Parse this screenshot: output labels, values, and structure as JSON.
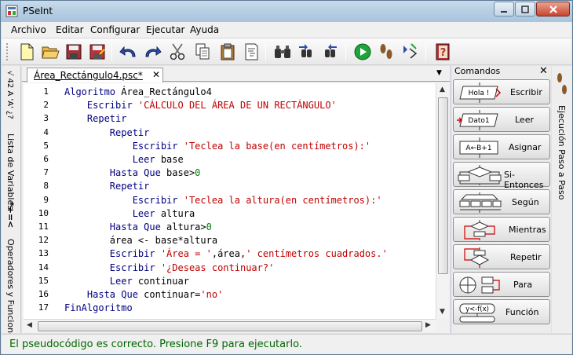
{
  "window": {
    "title": "PSeInt"
  },
  "menu": [
    "Archivo",
    "Editar",
    "Configurar",
    "Ejecutar",
    "Ayuda"
  ],
  "toolbar": {
    "buttons": [
      "new-file",
      "open-folder",
      "save",
      "save-as",
      "undo",
      "redo",
      "cut",
      "copy",
      "paste",
      "search",
      "find-next",
      "replace",
      "format",
      "run",
      "step-by-step",
      "draw-diagram",
      "help"
    ]
  },
  "left_strip": {
    "vars_symbol": "√ 42 A 'A' ¿?",
    "vars_label": "Lista de Variables",
    "ops_symbol": "*+=<",
    "ops_label": "Operadores y Funciones"
  },
  "tab": {
    "label": "Área_Rectángulo4.psc*",
    "close": "✕"
  },
  "code": {
    "lines": [
      [
        {
          "t": "Algoritmo ",
          "c": "kw"
        },
        {
          "t": "Área_Rectángulo4",
          "c": "id"
        }
      ],
      [
        {
          "t": "    Escribir ",
          "c": "kw"
        },
        {
          "t": "'CÁLCULO DEL ÁREA DE UN RECTÁNGULO'",
          "c": "str"
        }
      ],
      [
        {
          "t": "    Repetir",
          "c": "kw"
        }
      ],
      [
        {
          "t": "        Repetir",
          "c": "kw"
        }
      ],
      [
        {
          "t": "            Escribir ",
          "c": "kw"
        },
        {
          "t": "'Teclea la base(en centímetros):'",
          "c": "str"
        }
      ],
      [
        {
          "t": "            Leer ",
          "c": "kw"
        },
        {
          "t": "base",
          "c": "id"
        }
      ],
      [
        {
          "t": "        Hasta Que ",
          "c": "kw"
        },
        {
          "t": "base>",
          "c": "id"
        },
        {
          "t": "0",
          "c": "num"
        }
      ],
      [
        {
          "t": "        Repetir",
          "c": "kw"
        }
      ],
      [
        {
          "t": "            Escribir ",
          "c": "kw"
        },
        {
          "t": "'Teclea la altura(en centímetros):'",
          "c": "str"
        }
      ],
      [
        {
          "t": "            Leer ",
          "c": "kw"
        },
        {
          "t": "altura",
          "c": "id"
        }
      ],
      [
        {
          "t": "        Hasta Que ",
          "c": "kw"
        },
        {
          "t": "altura>",
          "c": "id"
        },
        {
          "t": "0",
          "c": "num"
        }
      ],
      [
        {
          "t": "        área <- base*altura",
          "c": "id"
        }
      ],
      [
        {
          "t": "        Escribir ",
          "c": "kw"
        },
        {
          "t": "'Área = '",
          "c": "str"
        },
        {
          "t": ",área,",
          "c": "id"
        },
        {
          "t": "' centímetros cuadrados.'",
          "c": "str"
        }
      ],
      [
        {
          "t": "        Escribir ",
          "c": "kw"
        },
        {
          "t": "'¿Deseas continuar?'",
          "c": "str"
        }
      ],
      [
        {
          "t": "        Leer ",
          "c": "kw"
        },
        {
          "t": "continuar",
          "c": "id"
        }
      ],
      [
        {
          "t": "    Hasta Que ",
          "c": "kw"
        },
        {
          "t": "continuar=",
          "c": "id"
        },
        {
          "t": "'no'",
          "c": "str"
        }
      ],
      [
        {
          "t": "FinAlgoritmo",
          "c": "kw"
        }
      ]
    ]
  },
  "commands": {
    "title": "Comandos",
    "close": "✕",
    "items": [
      {
        "label": "Escribir",
        "icon_text": "Hola !"
      },
      {
        "label": "Leer",
        "icon_text": "Dato1"
      },
      {
        "label": "Asignar",
        "icon_text": "A←B+1"
      },
      {
        "label": "Si-Entonces",
        "icon_text": ""
      },
      {
        "label": "Según",
        "icon_text": ""
      },
      {
        "label": "Mientras",
        "icon_text": ""
      },
      {
        "label": "Repetir",
        "icon_text": ""
      },
      {
        "label": "Para",
        "icon_text": ""
      },
      {
        "label": "Función",
        "icon_text": "y<-f(x)"
      }
    ]
  },
  "right_strip": {
    "label": "Ejecución Paso a Paso"
  },
  "status": {
    "text": "El pseudocódigo es correcto. Presione F9 para ejecutarlo."
  },
  "colors": {
    "keyword": "#000080",
    "string": "#c00000",
    "number": "#008000",
    "status": "#006600"
  }
}
